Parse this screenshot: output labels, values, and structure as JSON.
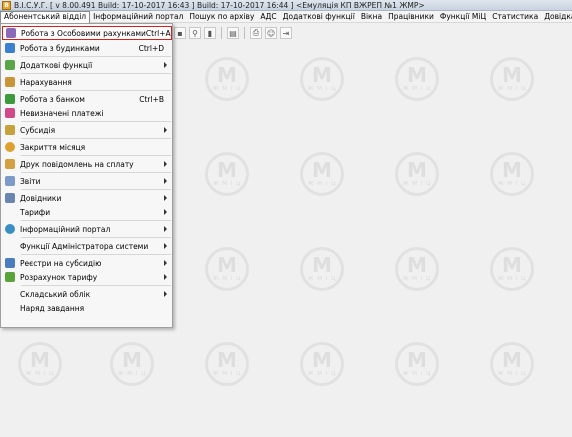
{
  "window": {
    "app_icon_letter": "B",
    "title": "В.І.С.У.Г. [ v 8.00.491 Build: 17-10-2017 16:43 ]   Build: 17-10-2017 16:44 ] <Емуляція КП ВЖРЕП №1 ЖМР>"
  },
  "menubar": {
    "items": [
      "Абонентський відділ",
      "Інформаційний портал",
      "Пошук по архіву",
      "АДС",
      "Додаткові функції",
      "Вікна",
      "Працівники",
      "Функції МіЦ",
      "Статистика",
      "Довідка"
    ]
  },
  "dropdown": {
    "items": [
      {
        "label": "Робота з Особовими рахунками",
        "shortcut": "Ctrl+A",
        "icon": "people-icon"
      },
      {
        "label": "Робота з будинками",
        "shortcut": "Ctrl+D",
        "icon": "house-icon"
      },
      {
        "label": "Додаткові функції",
        "shortcut": "",
        "icon": "puzzle-icon"
      },
      {
        "label": "Нарахування",
        "shortcut": "",
        "icon": "calculator-icon"
      },
      {
        "label": "Робота з банком",
        "shortcut": "Ctrl+B",
        "icon": "money-icon"
      },
      {
        "label": "Невизначені платежі",
        "shortcut": "",
        "icon": "question-payment-icon"
      },
      {
        "label": "Субсидія",
        "shortcut": "",
        "icon": "subsidy-icon"
      },
      {
        "label": "Закриття місяця",
        "shortcut": "",
        "icon": "lock-month-icon"
      },
      {
        "label": "Друк повідомлень на сплату",
        "shortcut": "",
        "icon": "print-icon"
      },
      {
        "label": "Звіти",
        "shortcut": "",
        "icon": "report-icon"
      },
      {
        "label": "Довідники",
        "shortcut": "",
        "icon": "directory-icon"
      },
      {
        "label": "Тарифи",
        "shortcut": "",
        "icon": ""
      },
      {
        "label": "Інформаційний портал",
        "shortcut": "",
        "icon": "globe-icon"
      },
      {
        "label": "Функції Адміністратора системи",
        "shortcut": "",
        "icon": ""
      },
      {
        "label": "Реєстри на субсидію",
        "shortcut": "",
        "icon": "registry-icon"
      },
      {
        "label": "Розрахунок тарифу",
        "shortcut": "",
        "icon": "tariff-calc-icon"
      },
      {
        "label": "Складський облік",
        "shortcut": "",
        "icon": ""
      },
      {
        "label": "Наряд завдання",
        "shortcut": "",
        "icon": ""
      }
    ]
  },
  "watermark": {
    "mark": "M",
    "text": "Ж М І Ц"
  },
  "colors": {
    "highlight_border": "#d42020",
    "menu_bg": "#f7f7f7",
    "workspace_bg": "#f0f0f0"
  }
}
